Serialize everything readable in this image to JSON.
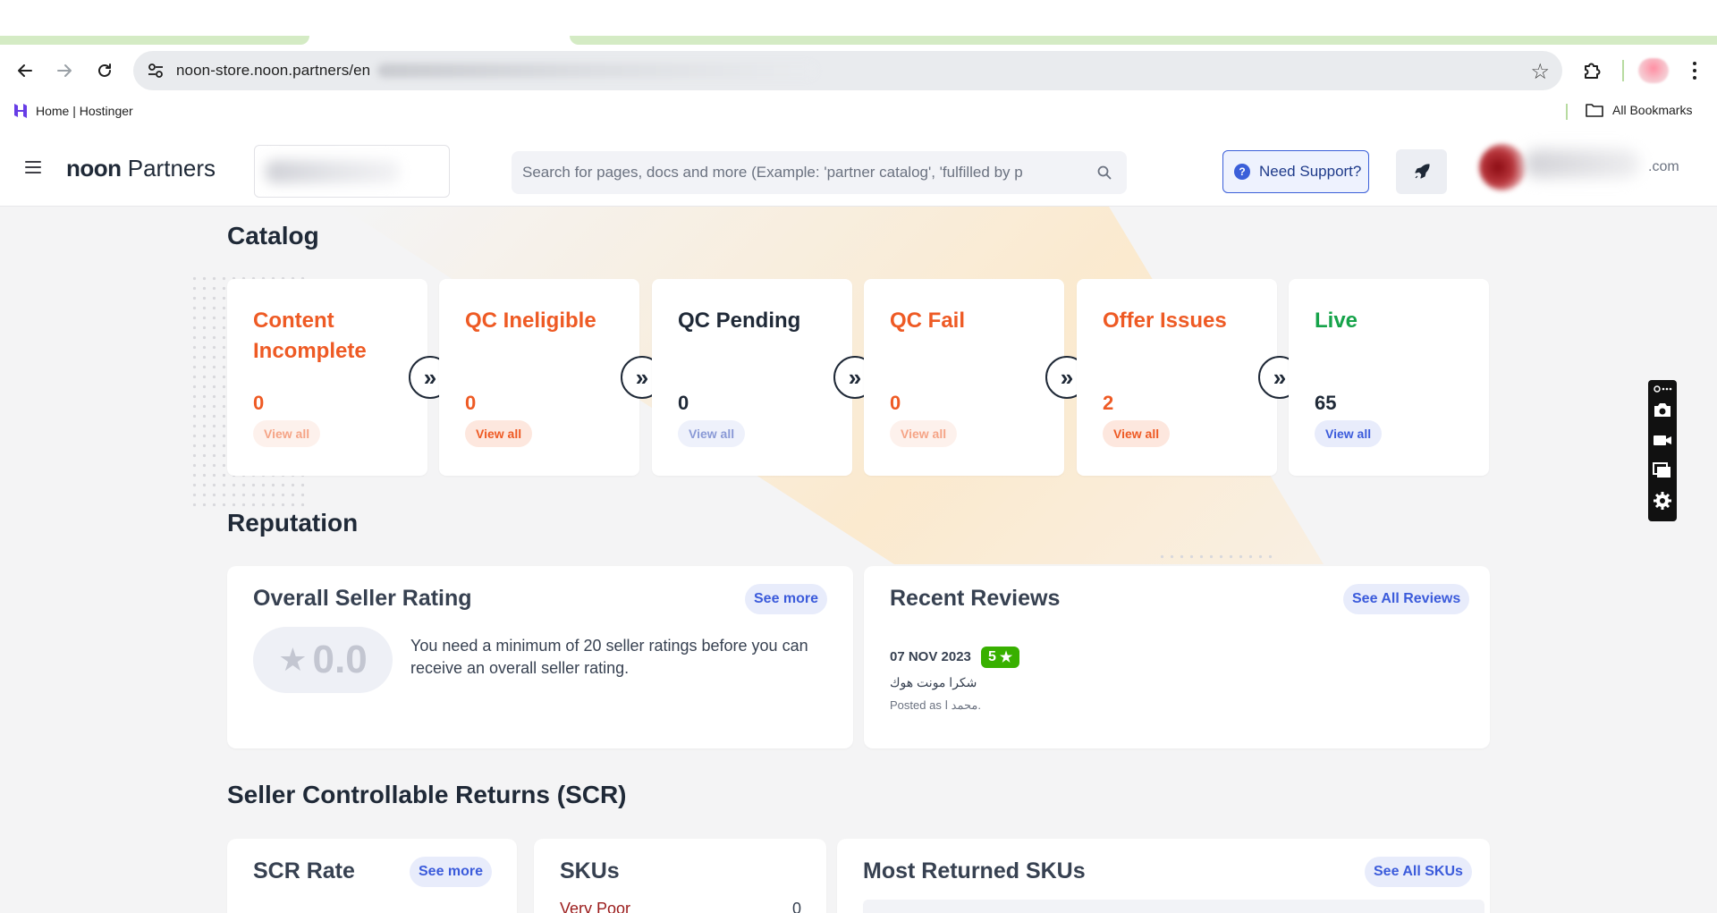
{
  "browser": {
    "url": "noon-store.noon.partners/en",
    "bookmark_home": "Home | Hostinger",
    "bookmark_all": "All Bookmarks"
  },
  "header": {
    "brand_bold": "noon",
    "brand_rest": " Partners",
    "search_placeholder": "Search for pages, docs and more (Example: 'partner catalog', 'fulfilled by p",
    "support_label": "Need Support?",
    "user_domain_suffix": ".com"
  },
  "colors": {
    "accent_orange": "#ee5a24",
    "accent_green": "#16a34a",
    "accent_blue": "#3b5bdb",
    "dark": "#1f2937"
  },
  "catalog": {
    "title": "Catalog",
    "cards": [
      {
        "name": "Content Incomplete",
        "count": "0",
        "view": "View all",
        "status": "orange"
      },
      {
        "name": "QC Ineligible",
        "count": "0",
        "view": "View all",
        "status": "orange"
      },
      {
        "name": "QC Pending",
        "count": "0",
        "view": "View all",
        "status": "dark"
      },
      {
        "name": "QC Fail",
        "count": "0",
        "view": "View all",
        "status": "orange"
      },
      {
        "name": "Offer Issues",
        "count": "2",
        "view": "View all",
        "status": "orange"
      },
      {
        "name": "Live",
        "count": "65",
        "view": "View all",
        "status": "green"
      }
    ]
  },
  "reputation": {
    "title": "Reputation",
    "rating_card": {
      "title": "Overall Seller Rating",
      "see_more": "See more",
      "value": "0.0",
      "message": "You need a minimum of 20 seller ratings before you can receive an overall seller rating."
    },
    "reviews_card": {
      "title": "Recent Reviews",
      "see_all": "See All Reviews",
      "review": {
        "date": "07 NOV 2023",
        "stars": "5",
        "text": "شكرا مونت هوك",
        "posted_as": "Posted as محمد ا."
      }
    }
  },
  "scr": {
    "title": "Seller Controllable Returns (SCR)",
    "rate_card": {
      "title": "SCR Rate",
      "see_more": "See more"
    },
    "skus_card": {
      "title": "SKUs",
      "row_label": "Very Poor",
      "row_value": "0"
    },
    "returned_card": {
      "title": "Most Returned SKUs",
      "see_all": "See All SKUs"
    }
  },
  "icons": {
    "back": "arrow-left-icon",
    "forward": "arrow-right-icon",
    "reload": "reload-icon",
    "bookmark_star": "star-icon",
    "extensions": "puzzle-icon",
    "support": "question-icon",
    "rocket": "rocket-icon",
    "next": "double-chevron-right-icon"
  }
}
